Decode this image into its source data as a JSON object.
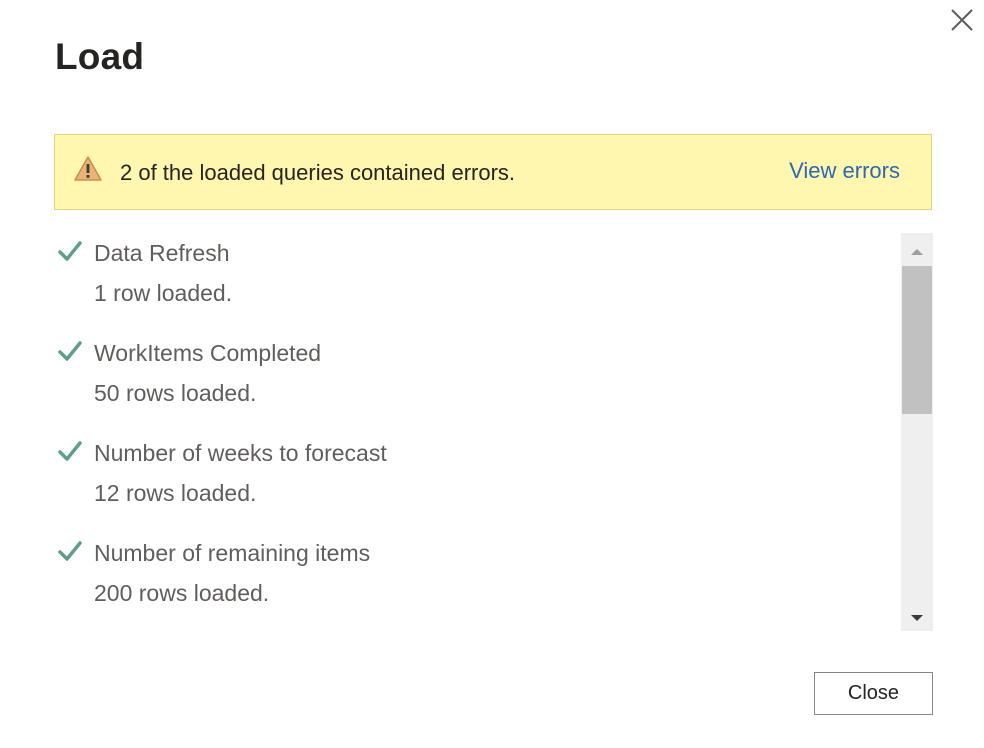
{
  "dialog": {
    "title": "Load",
    "close_icon": "close-icon"
  },
  "banner": {
    "icon": "warning-icon",
    "message": "2 of the loaded queries contained errors.",
    "link_label": "View errors",
    "background": "#fff6b0",
    "link_color": "#2f68b2"
  },
  "queries": [
    {
      "name": "Data Refresh",
      "status": "1 row loaded.",
      "icon": "checkmark-icon"
    },
    {
      "name": "WorkItems Completed",
      "status": "50 rows loaded.",
      "icon": "checkmark-icon"
    },
    {
      "name": "Number of weeks to forecast",
      "status": "12 rows loaded.",
      "icon": "checkmark-icon"
    },
    {
      "name": "Number of remaining items",
      "status": "200 rows loaded.",
      "icon": "checkmark-icon"
    }
  ],
  "colors": {
    "success_check": "#5f9e8a"
  },
  "footer": {
    "close_label": "Close"
  }
}
